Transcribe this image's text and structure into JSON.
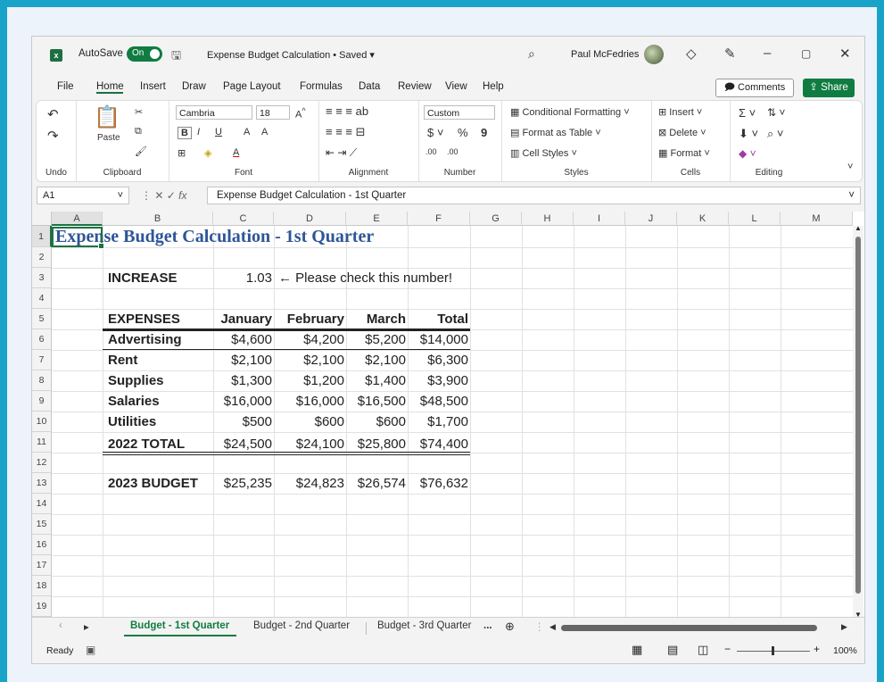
{
  "window": {
    "title": "Expense Budget Calculation • Saved",
    "autosave_label": "AutoSave",
    "autosave_state": "On",
    "user_name": "Paul McFedries"
  },
  "menu": [
    "File",
    "Home",
    "Insert",
    "Draw",
    "Page Layout",
    "Formulas",
    "Data",
    "Review",
    "View",
    "Help"
  ],
  "menu_active": "Home",
  "actions": {
    "comments": "Comments",
    "share": "Share"
  },
  "ribbon": {
    "undo": {
      "label": "Undo"
    },
    "clipboard": {
      "label": "Clipboard",
      "paste": "Paste"
    },
    "font": {
      "label": "Font",
      "family": "Cambria",
      "size": "18"
    },
    "alignment": {
      "label": "Alignment"
    },
    "number": {
      "label": "Number",
      "format": "Custom",
      "currency": "$",
      "percent": "%",
      "comma": "9",
      "dec_inc": ".00",
      "dec_dec": ".00"
    },
    "styles": {
      "label": "Styles",
      "items": [
        "Conditional Formatting",
        "Format as Table",
        "Cell Styles"
      ]
    },
    "cells": {
      "label": "Cells",
      "items": [
        "Insert",
        "Delete",
        "Format"
      ]
    },
    "editing": {
      "label": "Editing"
    }
  },
  "formula_bar": {
    "name_box": "A1",
    "formula": "Expense Budget Calculation - 1st Quarter",
    "fx": "fx"
  },
  "columns": [
    "A",
    "B",
    "C",
    "D",
    "E",
    "F",
    "G",
    "H",
    "I",
    "J",
    "K",
    "L",
    "M"
  ],
  "rows": [
    "1",
    "2",
    "3",
    "4",
    "5",
    "6",
    "7",
    "8",
    "9",
    "10",
    "11",
    "12",
    "13",
    "14",
    "15",
    "16",
    "17",
    "18",
    "19"
  ],
  "sheet": {
    "title": "Expense Budget Calculation - 1st Quarter",
    "increase_label": "INCREASE",
    "increase_value": "1.03",
    "increase_note": "← Please check this number!",
    "header": [
      "EXPENSES",
      "January",
      "February",
      "March",
      "Total"
    ],
    "expenses": [
      [
        "Advertising",
        "$4,600",
        "$4,200",
        "$5,200",
        "$14,000"
      ],
      [
        "Rent",
        "$2,100",
        "$2,100",
        "$2,100",
        "$6,300"
      ],
      [
        "Supplies",
        "$1,300",
        "$1,200",
        "$1,400",
        "$3,900"
      ],
      [
        "Salaries",
        "$16,000",
        "$16,000",
        "$16,500",
        "$48,500"
      ],
      [
        "Utilities",
        "$500",
        "$600",
        "$600",
        "$1,700"
      ]
    ],
    "total_row": [
      "2022 TOTAL",
      "$24,500",
      "$24,100",
      "$25,800",
      "$74,400"
    ],
    "budget_row": [
      "2023 BUDGET",
      "$25,235",
      "$24,823",
      "$26,574",
      "$76,632"
    ]
  },
  "sheet_tabs": [
    "Budget - 1st Quarter",
    "Budget - 2nd Quarter",
    "Budget - 3rd Quarter"
  ],
  "sheet_tabs_more": "...",
  "status": {
    "ready": "Ready",
    "zoom": "100%"
  }
}
